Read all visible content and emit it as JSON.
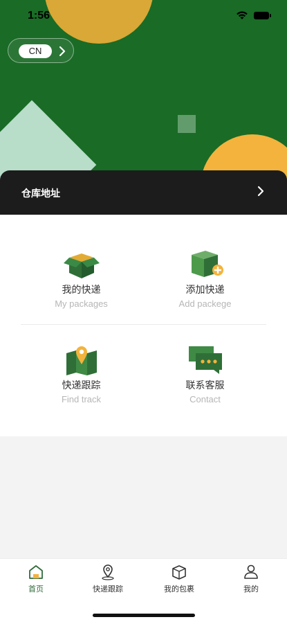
{
  "status_bar": {
    "time": "1:56"
  },
  "language": {
    "code": "CN"
  },
  "warehouse": {
    "label": "仓库地址"
  },
  "tiles": [
    {
      "cn": "我的快递",
      "en": "My packages",
      "icon": "open-box-icon"
    },
    {
      "cn": "添加快递",
      "en": "Add packege",
      "icon": "add-box-icon"
    },
    {
      "cn": "快递跟踪",
      "en": "Find track",
      "icon": "map-pin-icon"
    },
    {
      "cn": "联系客服",
      "en": "Contact",
      "icon": "chat-bubbles-icon"
    }
  ],
  "tabbar": {
    "items": [
      {
        "label": "首页",
        "icon": "home-icon",
        "active": true
      },
      {
        "label": "快递跟踪",
        "icon": "location-pin-icon",
        "active": false
      },
      {
        "label": "我的包裹",
        "icon": "package-icon",
        "active": false
      },
      {
        "label": "我的",
        "icon": "user-icon",
        "active": false
      }
    ]
  },
  "colors": {
    "brand_green": "#1a6b26",
    "accent_yellow": "#f4b33c",
    "dark_bar": "#1c1c1c"
  }
}
